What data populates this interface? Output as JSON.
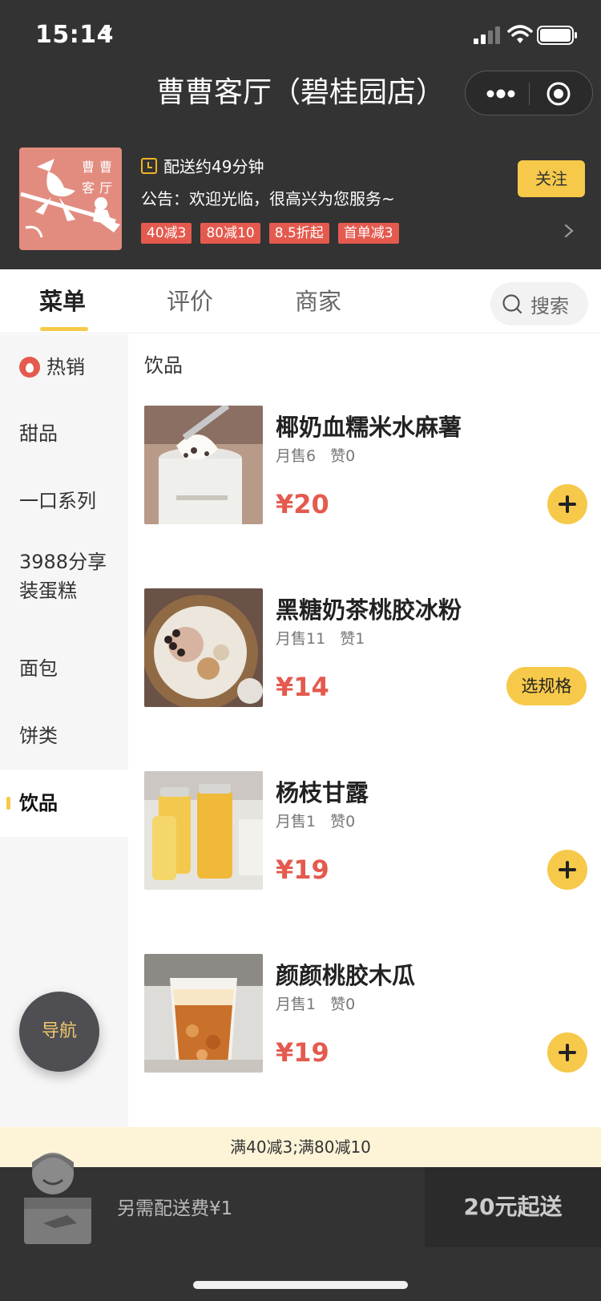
{
  "status_bar": {
    "time": "15:14"
  },
  "header": {
    "title": "曹曹客厅（碧桂园店）"
  },
  "shop": {
    "logo_text": "曹曹客厅",
    "delivery": "配送约49分钟",
    "notice": "公告：欢迎光临，很高兴为您服务~",
    "follow_label": "关注",
    "promos": [
      "40减3",
      "80减10",
      "8.5折起",
      "首单减3"
    ]
  },
  "tabs": [
    {
      "label": "菜单",
      "active": true
    },
    {
      "label": "评价",
      "active": false
    },
    {
      "label": "商家",
      "active": false
    }
  ],
  "search_label": "搜索",
  "categories": [
    {
      "label": "热销",
      "icon": "flame-icon"
    },
    {
      "label": "甜品"
    },
    {
      "label": "一口系列"
    },
    {
      "label": "3988分享装蛋糕"
    },
    {
      "label": "面包"
    },
    {
      "label": "饼类"
    },
    {
      "label": "饮品",
      "active": true
    }
  ],
  "nav_label": "导航",
  "section_title": "饮品",
  "products": [
    {
      "name": "椰奶血糯米水麻薯",
      "sold": "月售6",
      "likes": "赞0",
      "price": "¥20",
      "action": "add"
    },
    {
      "name": "黑糖奶茶桃胶冰粉",
      "sold": "月售11",
      "likes": "赞1",
      "price": "¥14",
      "action": "spec",
      "action_label": "选规格"
    },
    {
      "name": "杨枝甘露",
      "sold": "月售1",
      "likes": "赞0",
      "price": "¥19",
      "action": "add"
    },
    {
      "name": "颜颜桃胶木瓜",
      "sold": "月售1",
      "likes": "赞0",
      "price": "¥19",
      "action": "add"
    }
  ],
  "discount_bar": "满40减3;满80减10",
  "cart": {
    "fee": "另需配送费¥1",
    "min_order": "20元起送"
  },
  "colors": {
    "dark": "#333333",
    "accent_yellow": "#f7c94a",
    "price_red": "#e45a4e",
    "logo_bg": "#e28c80"
  }
}
